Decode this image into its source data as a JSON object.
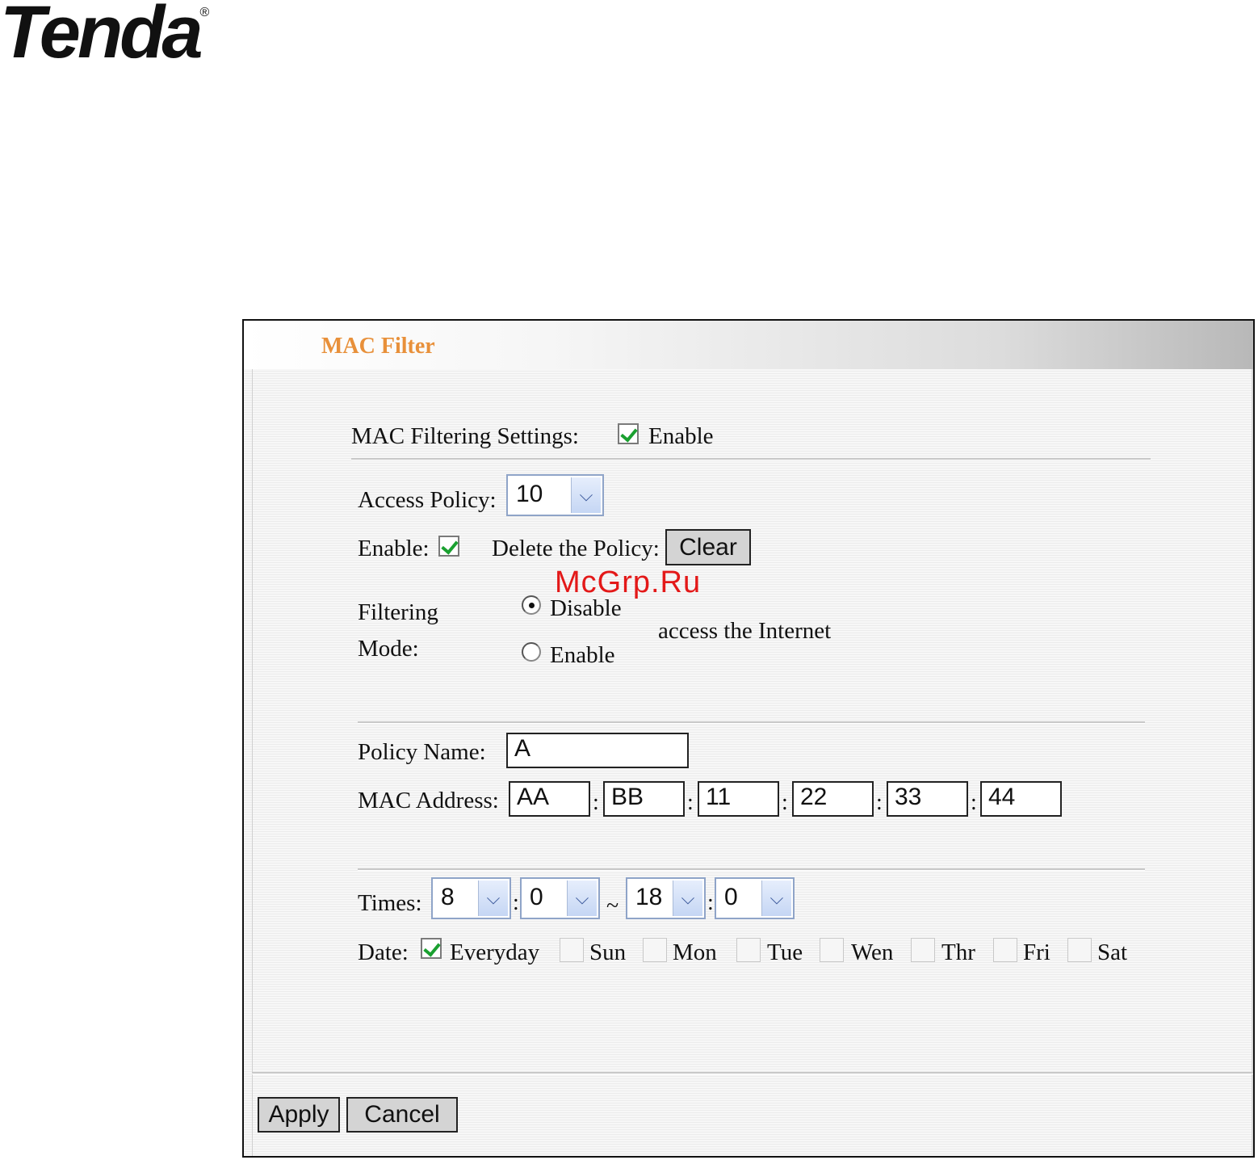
{
  "brand": {
    "logo_text": "Tenda",
    "registered_mark": "®"
  },
  "panel": {
    "title": "MAC Filter"
  },
  "mac_filtering": {
    "label": "MAC Filtering Settings:",
    "enable_label": "Enable",
    "enabled": true
  },
  "access_policy": {
    "label": "Access Policy:",
    "selected": "10"
  },
  "policy_enable": {
    "label": "Enable:",
    "checked": true
  },
  "delete_policy": {
    "label": "Delete the Policy:",
    "button": "Clear"
  },
  "filtering_mode": {
    "label_line1": "Filtering",
    "label_line2": "Mode:",
    "option_disable": "Disable",
    "option_enable": "Enable",
    "selected": "Disable",
    "suffix": "access the Internet"
  },
  "policy_name": {
    "label": "Policy Name:",
    "value": "A"
  },
  "mac_address": {
    "label": "MAC Address:",
    "octets": [
      "AA",
      "BB",
      "11",
      "22",
      "33",
      "44"
    ],
    "separator": ":"
  },
  "times": {
    "label": "Times:",
    "start_hour": "8",
    "start_minute": "0",
    "end_hour": "18",
    "end_minute": "0",
    "separator": ":",
    "range_sep": "~"
  },
  "date": {
    "label": "Date:",
    "everyday": {
      "label": "Everyday",
      "checked": true
    },
    "days": [
      {
        "label": "Sun",
        "checked": false
      },
      {
        "label": "Mon",
        "checked": false
      },
      {
        "label": "Tue",
        "checked": false
      },
      {
        "label": "Wen",
        "checked": false
      },
      {
        "label": "Thr",
        "checked": false
      },
      {
        "label": "Fri",
        "checked": false
      },
      {
        "label": "Sat",
        "checked": false
      }
    ]
  },
  "buttons": {
    "apply": "Apply",
    "cancel": "Cancel"
  },
  "watermark": "McGrp.Ru",
  "colors": {
    "title": "#e8903a",
    "check": "#1aa030",
    "watermark": "#e31818",
    "select_border": "#8fa4c8"
  }
}
